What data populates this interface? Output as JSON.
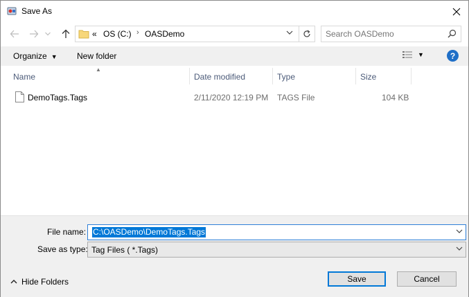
{
  "window": {
    "title": "Save As"
  },
  "nav": {
    "breadcrumb_overflow": "«",
    "path": [
      "OS (C:)",
      "OASDemo"
    ]
  },
  "search": {
    "placeholder": "Search OASDemo"
  },
  "toolbar": {
    "organize_label": "Organize",
    "new_folder_label": "New folder",
    "help_label": "?"
  },
  "columns": [
    "Name",
    "Date modified",
    "Type",
    "Size"
  ],
  "files": [
    {
      "name": "DemoTags.Tags",
      "date_modified": "2/11/2020 12:19 PM",
      "type": "TAGS File",
      "size": "104 KB"
    }
  ],
  "form": {
    "file_name_label": "File name:",
    "file_name_value": "C:\\OASDemo\\DemoTags.Tags",
    "save_type_label": "Save as type:",
    "save_type_value": "Tag Files  ( *.Tags)"
  },
  "footer": {
    "hide_folders_label": "Hide Folders",
    "save_label": "Save",
    "cancel_label": "Cancel"
  },
  "colors": {
    "accent": "#0078d7",
    "help_blue": "#1f6fc7",
    "header_text": "#4b5a78",
    "panel_bg": "#f0f0f0"
  }
}
